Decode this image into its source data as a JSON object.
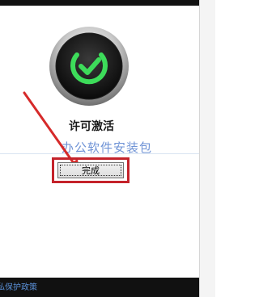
{
  "license": {
    "status_label": "许可激活",
    "status_icon": "check-circle-icon",
    "status_color": "#3ddc5a"
  },
  "watermark": {
    "text": "办公软件安装包"
  },
  "actions": {
    "done_label": "完成",
    "highlight_color": "#c4232b"
  },
  "footer": {
    "link_text": "私保护政策"
  }
}
